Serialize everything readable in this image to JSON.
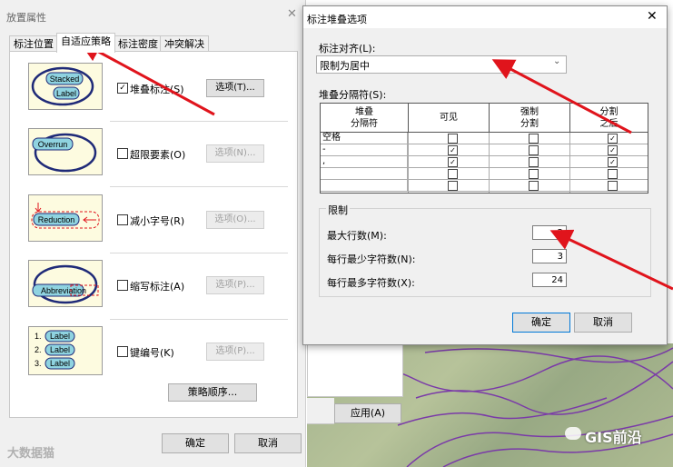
{
  "left_dialog": {
    "title": "放置属性",
    "tabs": [
      "标注位置",
      "自适应策略",
      "标注密度",
      "冲突解决"
    ],
    "active_tab": 1,
    "strategies": [
      {
        "preview": [
          "Stacked",
          "Label"
        ],
        "label": "堆叠标注(S)",
        "checked": true,
        "button": "选项(T)...",
        "enabled": true
      },
      {
        "preview": [
          "Overrun"
        ],
        "label": "超限要素(O)",
        "checked": false,
        "button": "选项(N)...",
        "enabled": false
      },
      {
        "preview": [
          "Reduction"
        ],
        "label": "减小字号(R)",
        "checked": false,
        "button": "选项(O)...",
        "enabled": false
      },
      {
        "preview": [
          "Abbreviation"
        ],
        "label": "缩写标注(A)",
        "checked": false,
        "button": "选项(P)...",
        "enabled": false
      },
      {
        "preview": [
          "1.",
          "2.",
          "3.",
          "Label"
        ],
        "label": "键编号(K)",
        "checked": false,
        "button": "选项(P)...",
        "enabled": false
      }
    ],
    "strategy_order_button": "策略顺序...",
    "ok": "确定",
    "cancel": "取消",
    "watermark": "大数据猫"
  },
  "apply_button": "应用(A)",
  "right_dialog": {
    "title": "标注堆叠选项",
    "align_label": "标注对齐(L):",
    "align_value": "限制为居中",
    "separator_label": "堆叠分隔符(S):",
    "table_headers": [
      "堆叠\n分隔符",
      "可见",
      "强制\n分割",
      "分割\n之后"
    ],
    "table_rows": [
      {
        "sep": "空格",
        "visible": false,
        "force": false,
        "after": true
      },
      {
        "sep": "-",
        "visible": true,
        "force": false,
        "after": true
      },
      {
        "sep": ",",
        "visible": true,
        "force": false,
        "after": true
      },
      {
        "sep": "",
        "visible": false,
        "force": false,
        "after": false
      },
      {
        "sep": "",
        "visible": false,
        "force": false,
        "after": false
      }
    ],
    "limit_title": "限制",
    "max_lines_label": "最大行数(M):",
    "max_lines": "2",
    "min_chars_label": "每行最少字符数(N):",
    "min_chars": "3",
    "max_chars_label": "每行最多字符数(X):",
    "max_chars": "24",
    "ok": "确定",
    "cancel": "取消"
  },
  "brand": "GIS前沿",
  "colors": {
    "arrow": "#e0141c",
    "preview_ellipse": "#1f2a78",
    "preview_fill": "#8fd3e0",
    "map_line": "#7a3aa8"
  }
}
